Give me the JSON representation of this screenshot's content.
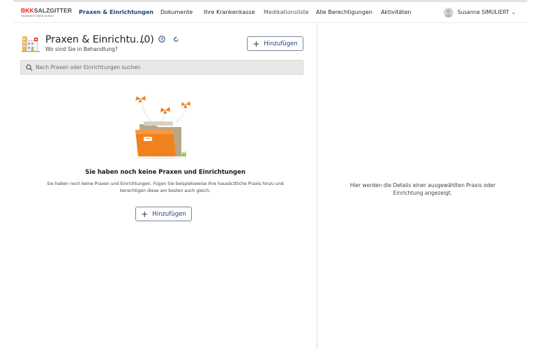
{
  "header": {
    "logo": {
      "brand_part1": "BKK",
      "brand_part2": "SALZGITTER",
      "tagline": "Gesundheit für Familie und Beruf"
    },
    "nav": [
      {
        "label": "Praxen & Einrichtungen",
        "active": true
      },
      {
        "label": "Dokumente"
      },
      {
        "label": "Ihre Krankenkasse"
      },
      {
        "label": "Medikationsliste"
      },
      {
        "label": "Alle Berechtigungen"
      },
      {
        "label": "Aktivitäten"
      }
    ],
    "user": {
      "name": "Susanne SIMULIERT",
      "menu_icon": "chevron-down-icon"
    }
  },
  "left_panel": {
    "title": "Praxen & Einrichtu...",
    "count": "(0)",
    "subtitle": "Wo sind Sie in Behandlung?",
    "add_button_label": "Hinzufügen",
    "search": {
      "placeholder": "Nach Praxen oder Einrichtungen suchen",
      "value": ""
    },
    "empty_state": {
      "title": "Sie haben noch keine Praxen und Einrichtungen",
      "description": "Sie haben noch keine Praxen und Einrichtungen. Fügen Sie beispielsweise Ihre hausärztliche Praxis hinzu und berechtigen diese am besten auch gleich.",
      "add_button_label": "Hinzufügen"
    }
  },
  "right_panel": {
    "message": "Hier werden die Details einer ausgewählten Praxis oder Einrichtung angezeigt."
  },
  "colors": {
    "brand_red": "#e2231a",
    "nav_active": "#1f3f7a",
    "folder_orange": "#f0821e",
    "search_bg": "#e8e8e8"
  }
}
